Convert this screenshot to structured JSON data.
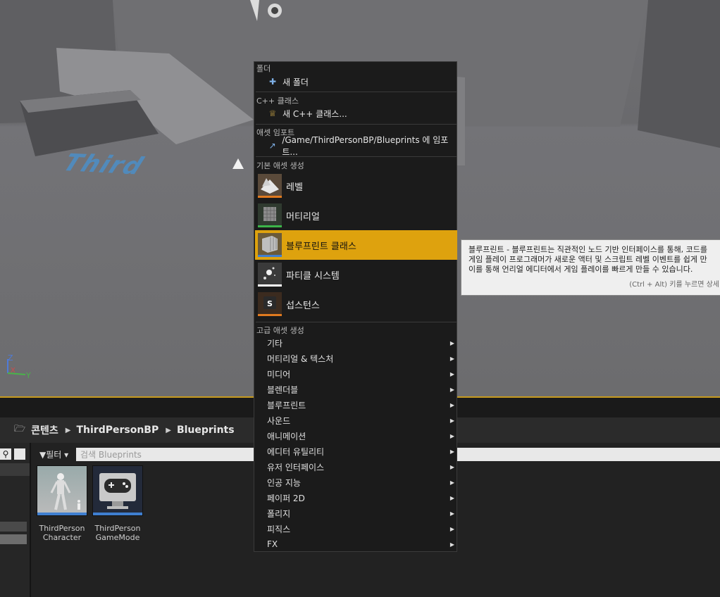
{
  "viewport": {
    "floor_text": "Third",
    "axis": {
      "z": "Z",
      "x": "X",
      "y": "Y"
    }
  },
  "content_browser": {
    "breadcrumb": [
      "콘텐츠",
      "ThirdPersonBP",
      "Blueprints"
    ],
    "filter_label": "필터",
    "search_placeholder": "검색 Blueprints",
    "assets": [
      {
        "line1": "ThirdPerson",
        "line2": "Character",
        "icon": "character-mannequin-icon"
      },
      {
        "line1": "ThirdPerson",
        "line2": "GameMode",
        "icon": "gamepad-icon"
      }
    ]
  },
  "context_menu": {
    "folder_header": "폴더",
    "new_folder": "새 폴더",
    "cpp_header": "C++ 클래스",
    "new_cpp": "새 C++ 클래스...",
    "import_header": "애셋 임포트",
    "import_item": "/Game/ThirdPersonBP/Blueprints 에 임포트...",
    "basic_header": "기본 애셋 생성",
    "basic_items": [
      {
        "label": "레벨",
        "color": "#e07a1f"
      },
      {
        "label": "머티리얼",
        "color": "#3cb54a"
      },
      {
        "label": "블루프린트 클래스",
        "color": "#3f7fd0",
        "highlighted": true
      },
      {
        "label": "파티클 시스템",
        "color": "#ffffff"
      },
      {
        "label": "섭스턴스",
        "color": "#e07a1f"
      }
    ],
    "advanced_header": "고급 애셋 생성",
    "advanced_items": [
      "기타",
      "머티리얼 & 텍스처",
      "미디어",
      "블렌더블",
      "블루프린트",
      "사운드",
      "애니메이션",
      "에디터 유틸리티",
      "유저 인터페이스",
      "인공 지능",
      "페이퍼 2D",
      "폴리지",
      "피직스",
      "FX"
    ]
  },
  "tooltip": {
    "line1": "블루프린트 - 블루프린트는 직관적인 노드 기반 인터페이스를 통해, 코드를",
    "line2": "게임 플레이 프로그래머가 새로운 액터 및 스크립트 레벨 이벤트를 쉽게 만",
    "line3": "이를 통해 언리얼 에디터에서 게임 플레이를 빠르게 만들 수 있습니다.",
    "hint": "(Ctrl + Alt) 키를 누르면 상세"
  },
  "colors": {
    "accent": "#dea20e",
    "menu_bg": "#1b1b1b"
  }
}
